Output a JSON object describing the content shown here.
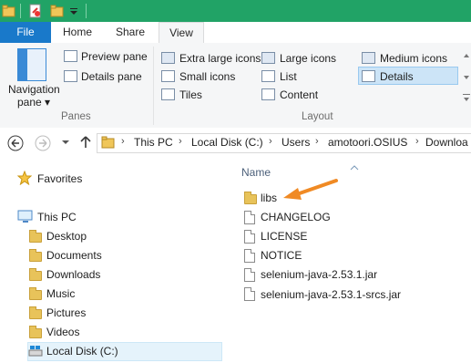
{
  "ribbon": {
    "tabs": {
      "file": "File",
      "home": "Home",
      "share": "Share",
      "view": "View"
    },
    "panes": {
      "navigation_pane": "Navigation",
      "navigation_pane_2": "pane ▾",
      "preview_pane": "Preview pane",
      "details_pane": "Details pane",
      "group_label": "Panes"
    },
    "layout": {
      "extra_large_icons": "Extra large icons",
      "large_icons": "Large icons",
      "medium_icons": "Medium icons",
      "small_icons": "Small icons",
      "list": "List",
      "details": "Details",
      "tiles": "Tiles",
      "content": "Content",
      "group_label": "Layout",
      "selected": "Details"
    }
  },
  "address": {
    "crumbs": [
      "This PC",
      "Local Disk (C:)",
      "Users",
      "amotoori.OSIUS",
      "Downloa"
    ]
  },
  "nav": {
    "favorites": "Favorites",
    "this_pc": "This PC",
    "items": [
      "Desktop",
      "Documents",
      "Downloads",
      "Music",
      "Pictures",
      "Videos",
      "Local Disk (C:)"
    ]
  },
  "content": {
    "column_name": "Name",
    "files": [
      {
        "name": "libs",
        "type": "folder"
      },
      {
        "name": "CHANGELOG",
        "type": "file"
      },
      {
        "name": "LICENSE",
        "type": "file"
      },
      {
        "name": "NOTICE",
        "type": "file"
      },
      {
        "name": "selenium-java-2.53.1.jar",
        "type": "file"
      },
      {
        "name": "selenium-java-2.53.1-srcs.jar",
        "type": "file"
      }
    ]
  },
  "colors": {
    "titlebar": "#21a366",
    "file_tab": "#1979ca",
    "arrow": "#f08a24"
  }
}
